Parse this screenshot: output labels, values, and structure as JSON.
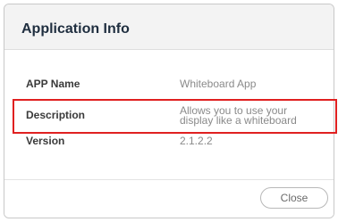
{
  "dialog": {
    "title": "Application Info",
    "rows": [
      {
        "label": "APP Name",
        "value": "Whiteboard App"
      },
      {
        "label": "Description",
        "value_lines": [
          "Allows you to use your",
          "display like a whiteboard"
        ]
      },
      {
        "label": "Version",
        "value": "2.1.2.2"
      }
    ],
    "close_label": "Close"
  },
  "colors": {
    "highlight": "#e02020",
    "title_text": "#1f2e3f",
    "header_bg": "#f3f3f3"
  }
}
